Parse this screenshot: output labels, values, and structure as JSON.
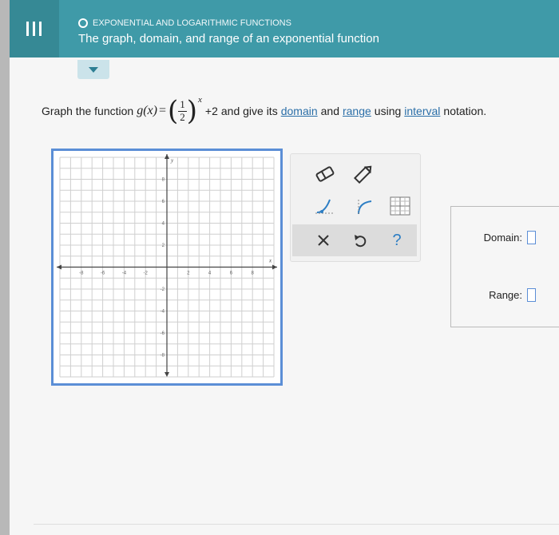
{
  "header": {
    "topic": "EXPONENTIAL AND LOGARITHMIC FUNCTIONS",
    "title": "The graph, domain, and range of an exponential function"
  },
  "problem": {
    "prefix": "Graph the function",
    "function_name": "g",
    "variable": "(x)",
    "equals": "=",
    "numerator": "1",
    "denominator": "2",
    "exponent": "x",
    "suffix_plus": "+2",
    "mid_text": "and give its",
    "domain_link": "domain",
    "and": "and",
    "range_link": "range",
    "using": "using",
    "interval_link": "interval",
    "notation": "notation."
  },
  "graph": {
    "x_axis_label": "x",
    "y_axis_label": "y",
    "x_ticks": [
      "-8",
      "-6",
      "-4",
      "-2",
      "2",
      "4",
      "6",
      "8"
    ],
    "y_ticks": [
      "8",
      "6",
      "4",
      "2",
      "-2",
      "-4",
      "-6",
      "-8"
    ],
    "xlim": [
      -10,
      10
    ],
    "ylim": [
      -10,
      10
    ]
  },
  "toolbox": {
    "icons": [
      "eraser-icon",
      "pencil-icon",
      "exponential-curve-icon",
      "asymptote-curve-icon",
      "grid-tool-icon",
      "close-icon",
      "undo-icon",
      "help-icon"
    ]
  },
  "answers": {
    "domain_label": "Domain:",
    "range_label": "Range:"
  },
  "colors": {
    "header_bg": "#3f9aa8",
    "graph_border": "#5b8ed6",
    "link": "#2b6fa8"
  }
}
